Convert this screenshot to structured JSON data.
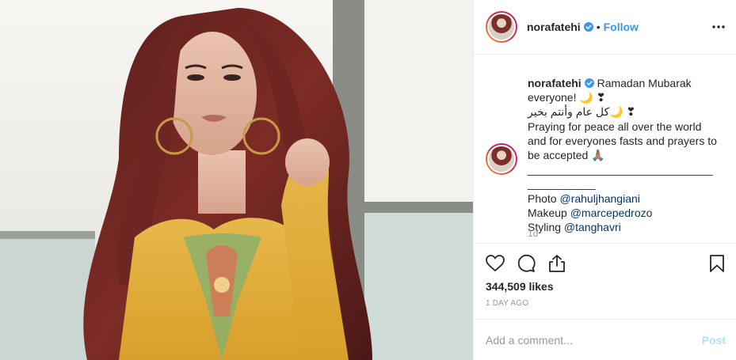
{
  "post": {
    "photo_alt": "norafatehi post photo",
    "header": {
      "username": "norafatehi",
      "separator": "•",
      "follow_label": "Follow"
    },
    "caption": {
      "username": "norafatehi",
      "lines": [
        "Ramadan Mubarak",
        "everyone! 🌙 ❣",
        "كل عام وأنتم بخير🌙 ❣",
        "Praying for peace all over the world",
        "and for everyones fasts and prayers to",
        "be accepted 🙏🏽",
        "______________________________",
        "___________"
      ],
      "credits": [
        {
          "label": "Photo",
          "mention": "@rahuljhangiani"
        },
        {
          "label": "Makeup",
          "mention": "@marcepedrozo"
        },
        {
          "label": "Styling",
          "mention": "@tanghavri"
        }
      ],
      "time": "1d"
    },
    "likes": "344,509 likes",
    "posted": "1 DAY AGO",
    "composer": {
      "placeholder": "Add a comment...",
      "post_label": "Post"
    },
    "colors": {
      "link": "#3897f0",
      "mention": "#003569",
      "muted": "#999999",
      "border": "#efefef"
    }
  }
}
